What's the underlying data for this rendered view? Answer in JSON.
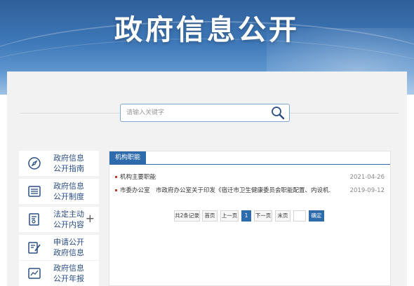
{
  "banner": {
    "title": "政府信息公开"
  },
  "search": {
    "placeholder": "请输入关键字",
    "value": ""
  },
  "sidebar": {
    "items": [
      {
        "label": "政府信息公开指南",
        "icon": "compass-icon"
      },
      {
        "label": "政府信息公开制度",
        "icon": "list-document-icon"
      },
      {
        "label": "法定主动公开内容",
        "icon": "folder-document-icon",
        "expand": "+"
      },
      {
        "label": "申请公开政府信息",
        "icon": "edit-document-icon"
      },
      {
        "label": "政府信息公开年报",
        "icon": "chart-report-icon"
      }
    ]
  },
  "main": {
    "tab": "机构职能",
    "rows": [
      {
        "title": "机构主要职能",
        "date": "2021-04-26"
      },
      {
        "title": "市委办公室　市政府办公室关于印发《宿迁市卫生健康委员会职能配置、内设机...",
        "date": "2019-09-12"
      }
    ],
    "pager": {
      "total": "共2条记录",
      "first": "首页",
      "prev": "上一页",
      "current": "1",
      "next": "下一页",
      "last": "末页",
      "jump_value": "",
      "confirm": "确定"
    }
  },
  "colors": {
    "primary": "#2e6bad",
    "banner": "#3e78b8",
    "panel": "#f2f2f2"
  }
}
